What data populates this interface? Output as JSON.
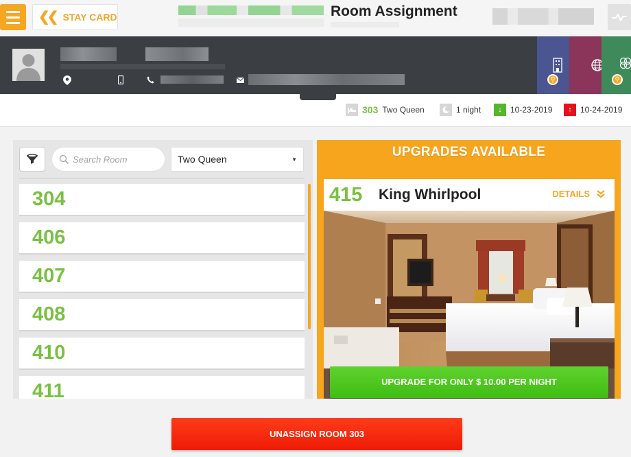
{
  "header": {
    "page_title": "Room Assignment",
    "back_label": "STAY CARD"
  },
  "reservation": {
    "current_room": "303",
    "current_room_type": "Two Queen",
    "nights": "1 night",
    "arrival_date": "10-23-2019",
    "departure_date": "10-24-2019"
  },
  "room_filter": {
    "search_placeholder": "Search Room",
    "selected_type": "Two Queen"
  },
  "available_rooms": [
    "304",
    "406",
    "407",
    "408",
    "410",
    "411"
  ],
  "upgrades": {
    "heading": "UPGRADES AVAILABLE",
    "room_number": "415",
    "room_type": "King Whirlpool",
    "details_label": "DETAILS",
    "upgrade_button": "UPGRADE FOR ONLY $ 10.00 PER NIGHT"
  },
  "footer": {
    "unassign_button": "UNASSIGN ROOM 303"
  },
  "colors": {
    "accent": "#f5a623",
    "room_green": "#79c043",
    "header_dark": "#3b3f44",
    "upgrade_green": "#45c11b",
    "unassign_red": "#f0200a",
    "arrival_icon": "#55b52d",
    "departure_icon": "#e8101c"
  },
  "icons": {
    "menu": "hamburger-icon",
    "back": "double-chevron-left-icon",
    "activity": "activity-icon",
    "filter": "funnel-icon",
    "search": "search-icon",
    "bed": "bed-icon",
    "moon": "moon-icon",
    "arrival": "arrow-down-icon",
    "departure": "arrow-up-icon"
  }
}
